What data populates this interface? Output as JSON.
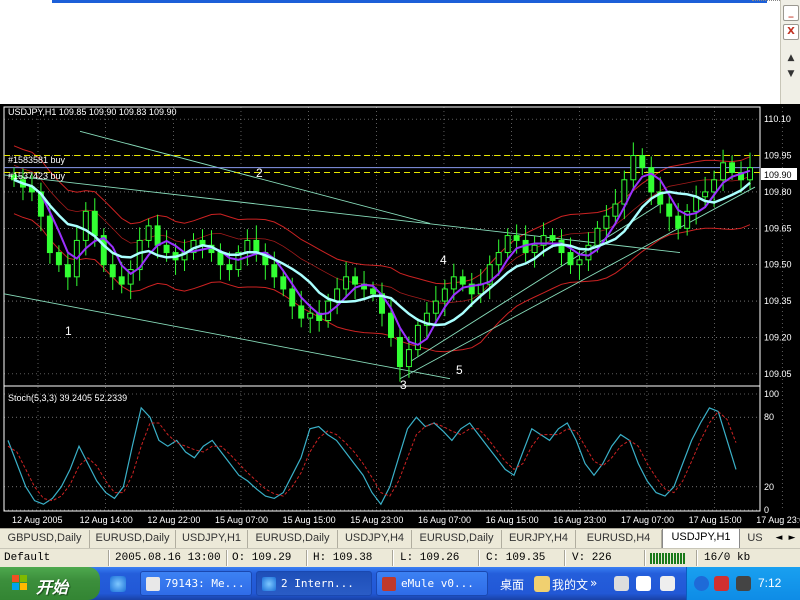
{
  "window": {
    "min_symbol": "_",
    "close_symbol": "X",
    "scroll_up_symbol": "▲",
    "scroll_down_symbol": "▼"
  },
  "chart": {
    "header": "USDJPY,H1  109.85 109.90 109.83 109.90",
    "current_price": "109.90",
    "order_labels": [
      "#1583581 buy",
      "#1537423 buy"
    ],
    "wave_labels": [
      "1",
      "2",
      "3",
      "4",
      "5"
    ],
    "stoch_header": "Stoch(5,3,3) 39.2405 52.2339",
    "colors": {
      "background": "#000000",
      "candle_up": "#33ff33",
      "candle_down": "#33ff33",
      "ma_fast": "#9b30ff",
      "ma_slow": "#aaffff",
      "bands": "#cc2222",
      "channel": "#88ddbb",
      "order_line": "#e6e600",
      "stoch_main": "#3ab0c8",
      "stoch_signal": "#cc2222",
      "grid": "#ffffff"
    }
  },
  "chart_data": {
    "type": "candlestick",
    "symbol": "USDJPY",
    "timeframe": "H1",
    "price_ticks": [
      "110.10",
      "109.95",
      "109.80",
      "109.65",
      "109.50",
      "109.35",
      "109.20",
      "109.05"
    ],
    "ylim": [
      109.0,
      110.15
    ],
    "time_ticks": [
      "12 Aug 2005",
      "12 Aug 14:00",
      "12 Aug 22:00",
      "15 Aug 07:00",
      "15 Aug 15:00",
      "15 Aug 23:00",
      "16 Aug 07:00",
      "16 Aug 15:00",
      "16 Aug 23:00",
      "17 Aug 07:00",
      "17 Aug 15:00",
      "17 Aug 23:00"
    ],
    "stoch_ticks": [
      "100",
      "80",
      "20",
      "0"
    ],
    "stoch_ylim": [
      0,
      100
    ],
    "close_series": [
      109.85,
      109.82,
      109.8,
      109.7,
      109.55,
      109.5,
      109.45,
      109.6,
      109.72,
      109.62,
      109.5,
      109.45,
      109.42,
      109.48,
      109.6,
      109.66,
      109.58,
      109.55,
      109.52,
      109.55,
      109.6,
      109.58,
      109.55,
      109.5,
      109.48,
      109.55,
      109.6,
      109.55,
      109.5,
      109.45,
      109.4,
      109.33,
      109.28,
      109.3,
      109.27,
      109.35,
      109.4,
      109.45,
      109.42,
      109.4,
      109.38,
      109.3,
      109.2,
      109.08,
      109.15,
      109.25,
      109.3,
      109.35,
      109.4,
      109.45,
      109.42,
      109.38,
      109.42,
      109.5,
      109.55,
      109.62,
      109.6,
      109.55,
      109.58,
      109.62,
      109.6,
      109.55,
      109.5,
      109.52,
      109.58,
      109.65,
      109.7,
      109.75,
      109.85,
      109.95,
      109.9,
      109.8,
      109.75,
      109.7,
      109.65,
      109.72,
      109.78,
      109.8,
      109.85,
      109.92,
      109.88,
      109.85,
      109.9
    ],
    "stoch_main": [
      60,
      40,
      20,
      8,
      5,
      10,
      20,
      35,
      55,
      40,
      25,
      15,
      10,
      20,
      55,
      88,
      80,
      60,
      55,
      60,
      50,
      45,
      55,
      60,
      50,
      40,
      30,
      25,
      18,
      12,
      10,
      15,
      30,
      45,
      70,
      72,
      65,
      60,
      50,
      40,
      30,
      15,
      5,
      20,
      45,
      70,
      80,
      72,
      75,
      68,
      60,
      70,
      75,
      65,
      55,
      45,
      35,
      30,
      50,
      70,
      65,
      60,
      70,
      75,
      60,
      40,
      30,
      40,
      55,
      65,
      60,
      40,
      25,
      15,
      12,
      20,
      40,
      60,
      75,
      88,
      85,
      60,
      35
    ],
    "stoch_signal": [
      55,
      50,
      35,
      20,
      10,
      8,
      12,
      22,
      38,
      45,
      38,
      25,
      15,
      15,
      30,
      55,
      75,
      75,
      65,
      58,
      55,
      52,
      50,
      55,
      55,
      48,
      40,
      32,
      25,
      18,
      14,
      12,
      20,
      32,
      50,
      62,
      68,
      65,
      58,
      50,
      40,
      28,
      15,
      12,
      25,
      45,
      65,
      72,
      75,
      72,
      68,
      65,
      70,
      70,
      62,
      52,
      42,
      35,
      40,
      55,
      65,
      65,
      65,
      70,
      68,
      55,
      42,
      38,
      45,
      55,
      60,
      55,
      40,
      28,
      18,
      15,
      25,
      42,
      60,
      75,
      85,
      78,
      58
    ]
  },
  "tabs": [
    "GBPUSD,Daily",
    "EURUSD,Daily",
    "USDJPY,H1",
    "EURUSD,Daily",
    "USDJPY,H4",
    "EURUSD,Daily",
    "EURJPY,H4",
    "EURUSD,H4",
    "USDJPY,H1",
    "US"
  ],
  "active_tab": "USDJPY,H1",
  "tab_arrows": [
    "◄",
    "►"
  ],
  "status": {
    "profile": "Default",
    "datetime": "2005.08.16 13:00",
    "open": "O: 109.29",
    "high": "H: 109.38",
    "low": "L: 109.26",
    "close": "C: 109.35",
    "volume": "V: 226",
    "traffic": "16/0 kb"
  },
  "taskbar": {
    "start_label": "开始",
    "tasks": [
      "79143: Me...",
      "2 Intern...",
      "eMule v0...",
      "我的文"
    ],
    "desktop_label": "桌面",
    "clock": "7:12"
  }
}
